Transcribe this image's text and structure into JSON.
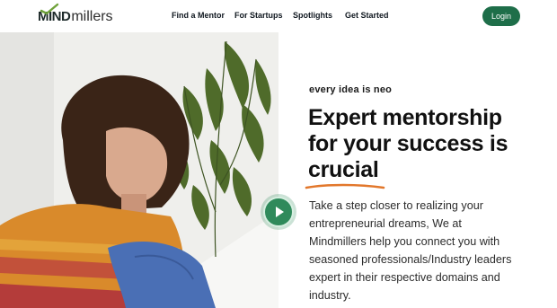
{
  "brand": {
    "logo_part1": "MIND",
    "logo_part2": "millers",
    "accent_color": "#1e6e49",
    "logo_accent_color": "#6fa23a"
  },
  "nav": {
    "items": [
      {
        "label": "Find a Mentor"
      },
      {
        "label": "For Startups"
      },
      {
        "label": "Spotlights"
      },
      {
        "label": "Get Started"
      }
    ],
    "login_label": "Login"
  },
  "hero": {
    "tagline": "every idea is neo",
    "headline": {
      "line1": "Expert mentorship",
      "line2": "for your success is",
      "highlight": "crucial"
    },
    "highlight_color": "#e2772b",
    "description_lines": [
      "Take a step closer to realizing your",
      "entrepreneurial dreams, We at",
      "Mindmillers help you connect you with",
      "seasoned professionals/Industry leaders",
      "expert in their respective domains and",
      "industry."
    ],
    "play_icon": "play-icon",
    "image": "woman-sitting-by-plant"
  }
}
